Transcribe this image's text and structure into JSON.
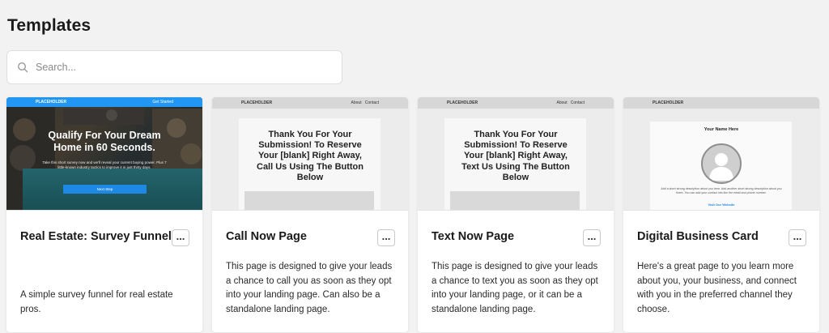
{
  "page": {
    "title": "Templates"
  },
  "search": {
    "placeholder": "Search..."
  },
  "cards": [
    {
      "title": "Real Estate: Survey Funnel",
      "description": "A simple survey funnel for real estate pros.",
      "preview": {
        "logo": "PLACEHOLDER",
        "nav_link": "Get Started",
        "headline": "Qualify For Your Dream Home in 60 Seconds.",
        "subtext": "Take this short survey now and we'll reveal your current buying power. Plus 7 little-known industry tactics to improve it in just thirty days.",
        "button": "Next Step",
        "bar_color": "#2196f3"
      }
    },
    {
      "title": "Call Now Page",
      "description": "This page is designed to give your leads a chance to call you as soon as they opt into your landing page. Can also be a standalone landing page.",
      "preview": {
        "logo": "PLACEHOLDER",
        "nav_about": "About",
        "nav_contact": "Contact",
        "headline": "Thank You For Your Submission! To Reserve Your [blank] Right Away, Call Us Using The Button Below"
      }
    },
    {
      "title": "Text Now Page",
      "description": "This page is designed to give your leads a chance to text you as soon as they opt into your landing page, or it can be a standalone landing page.",
      "preview": {
        "logo": "PLACEHOLDER",
        "nav_about": "About",
        "nav_contact": "Contact",
        "headline": "Thank You For Your Submission! To Reserve Your [blank] Right Away, Text Us Using The Button Below"
      }
    },
    {
      "title": "Digital Business Card",
      "description": "Here's a great page to you learn more about you, your business, and connect with you in the preferred channel they choose.",
      "preview": {
        "logo": "PLACEHOLDER",
        "name": "Your Name Here",
        "text": "Add a short strong description about you here. Add another short strong description about you there. You can add your contact info like the email and phone number.",
        "link": "Visit Our Website"
      }
    }
  ],
  "more_label": "..."
}
